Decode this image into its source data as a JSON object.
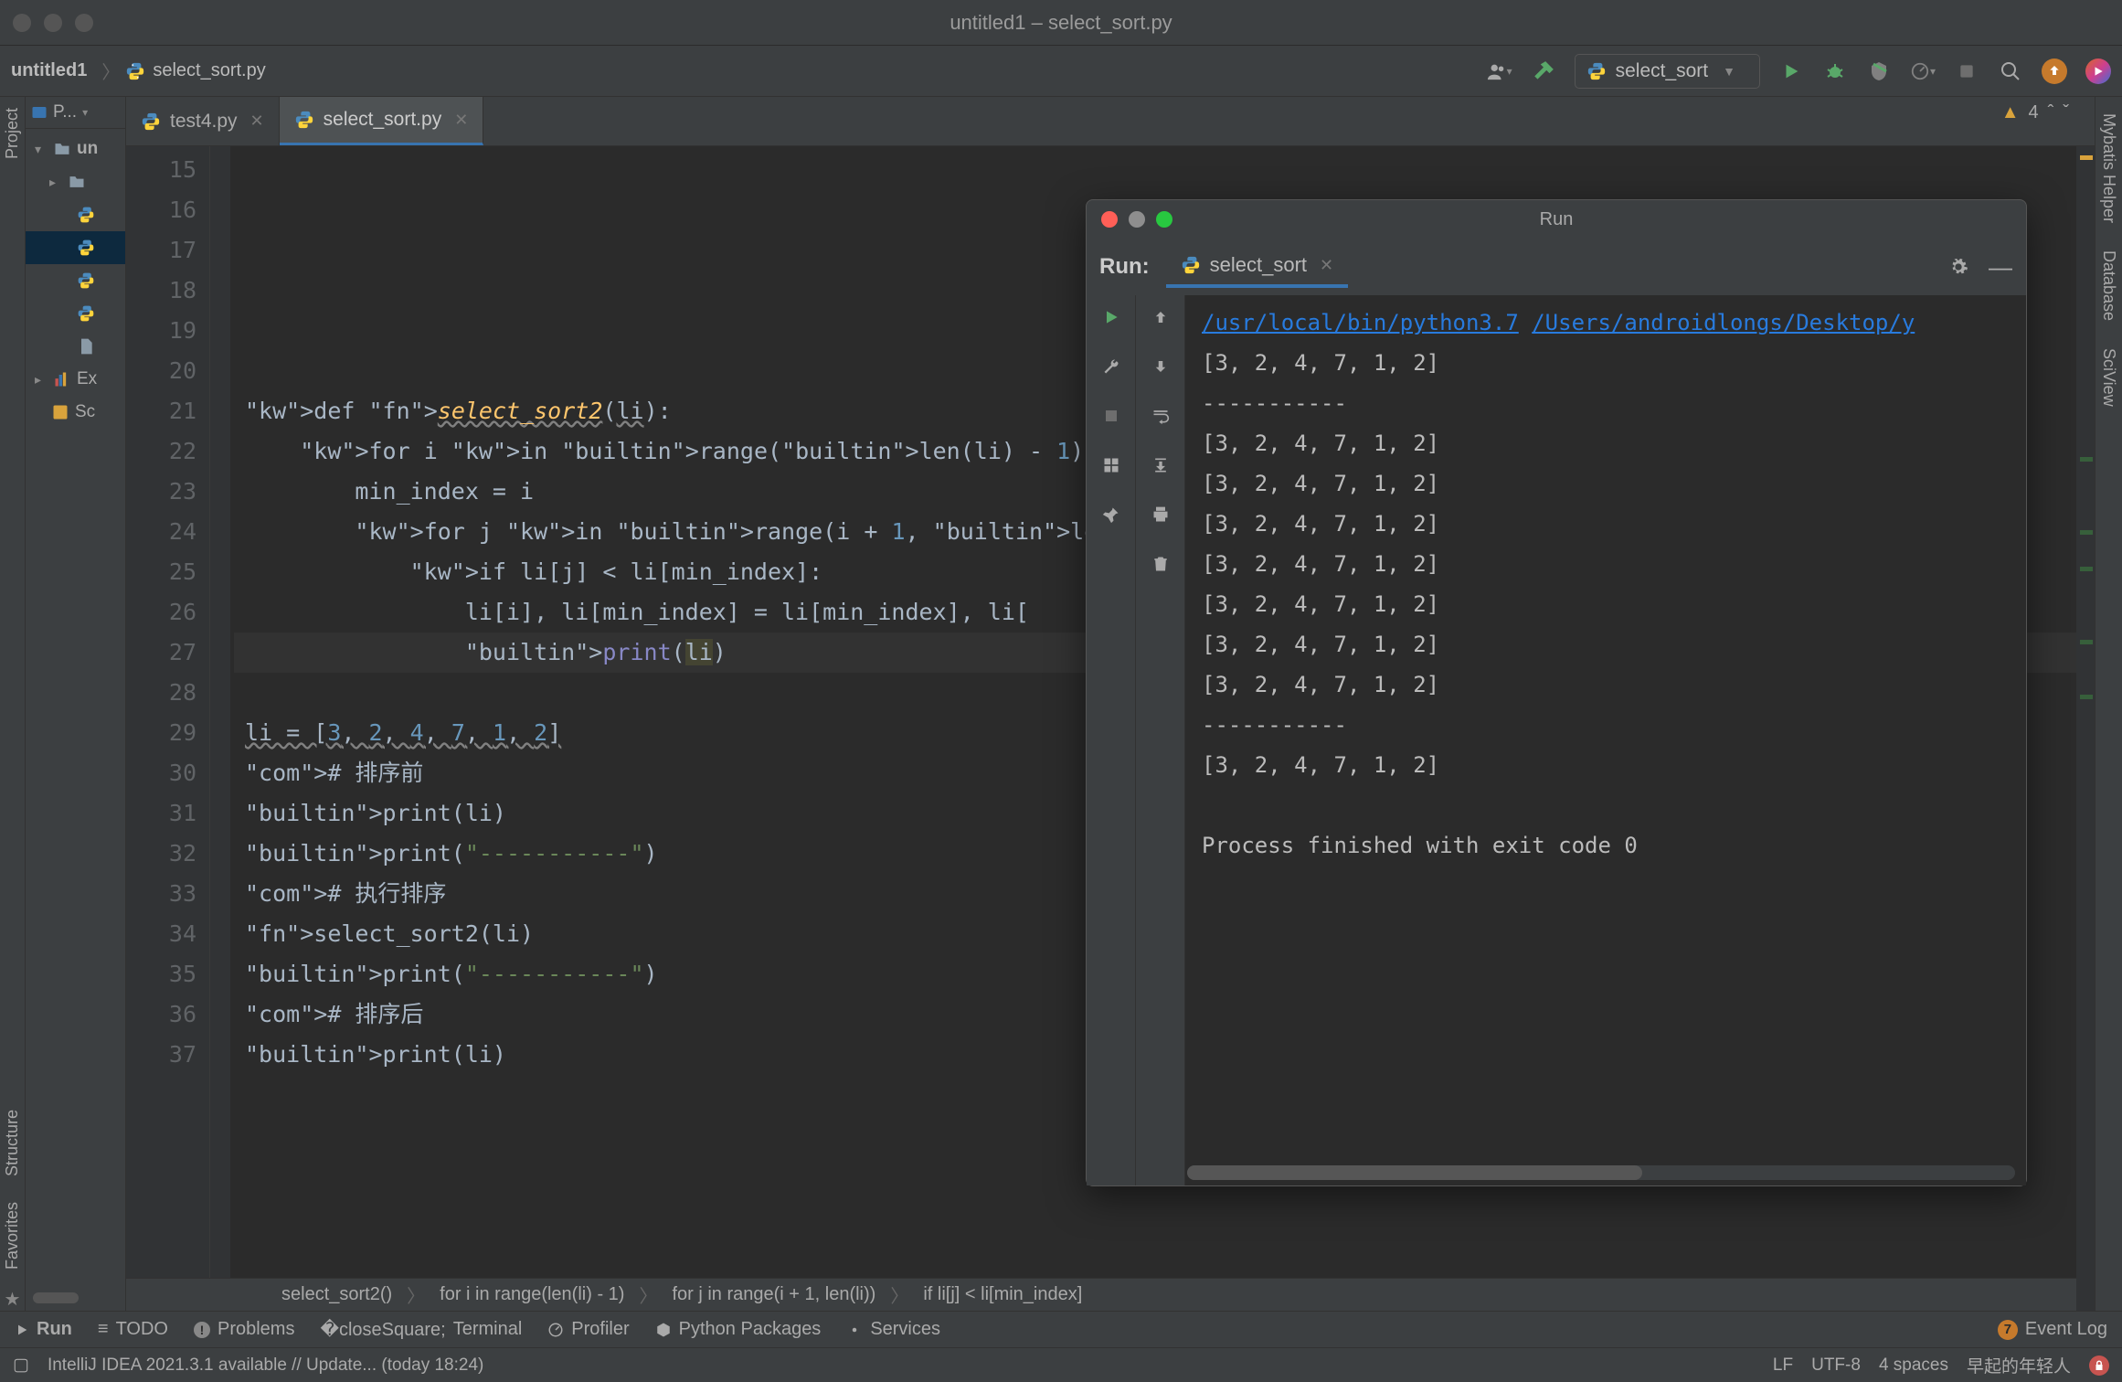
{
  "window_title": "untitled1 – select_sort.py",
  "breadcrumb_top": {
    "project": "untitled1",
    "file": "select_sort.py"
  },
  "toolbar_right": {
    "run_config": "select_sort"
  },
  "project_tree": {
    "header_label": "P...",
    "root_label": "un",
    "ext_label": "Ex",
    "sc_label": "Sc",
    "line_start": 15
  },
  "left_vert_tabs": [
    "Project",
    "Structure",
    "Favorites"
  ],
  "right_vert_tabs": [
    "Mybatis Helper",
    "Database",
    "SciView"
  ],
  "editor_tabs": [
    {
      "label": "test4.py",
      "active": false
    },
    {
      "label": "select_sort.py",
      "active": true
    }
  ],
  "warnings_count": "4",
  "code": {
    "gutter_start": 15,
    "lines": [
      "",
      "",
      "",
      "",
      "",
      "",
      "def select_sort2(li):",
      "    for i in range(len(li) - 1):",
      "        min_index = i",
      "        for j in range(i + 1, len(li)):",
      "            if li[j] < li[min_index]:",
      "                li[i], li[min_index] = li[min_index], li[",
      "                print(li)",
      "",
      "li = [3, 2, 4, 7, 1, 2]",
      "# 排序前",
      "print(li)",
      "print(\"-----------\")",
      "# 执行排序",
      "select_sort2(li)",
      "print(\"-----------\")",
      "# 排序后",
      "print(li)",
      ""
    ],
    "highlighted_line_index": 12
  },
  "breadcrumb_bottom": [
    "select_sort2()",
    "for i in range(len(li) - 1)",
    "for j in range(i + 1, len(li))",
    "if li[j] < li[min_index]"
  ],
  "run_window": {
    "title": "Run",
    "panel_label": "Run:",
    "tab_label": "select_sort",
    "link1": "/usr/local/bin/python3.7",
    "link2": "/Users/androidlongs/Desktop/y",
    "output_lines": [
      "[3, 2, 4, 7, 1, 2]",
      "-----------",
      "[3, 2, 4, 7, 1, 2]",
      "[3, 2, 4, 7, 1, 2]",
      "[3, 2, 4, 7, 1, 2]",
      "[3, 2, 4, 7, 1, 2]",
      "[3, 2, 4, 7, 1, 2]",
      "[3, 2, 4, 7, 1, 2]",
      "[3, 2, 4, 7, 1, 2]",
      "-----------",
      "[3, 2, 4, 7, 1, 2]",
      "",
      "Process finished with exit code 0"
    ]
  },
  "bottom_tools": {
    "run": "Run",
    "todo": "TODO",
    "problems": "Problems",
    "terminal": "Terminal",
    "profiler": "Profiler",
    "packages": "Python Packages",
    "services": "Services",
    "eventlog": "Event Log",
    "eventlog_badge": "7"
  },
  "status_bar": {
    "msg": "IntelliJ IDEA 2021.3.1 available // Update... (today 18:24)",
    "lf": "LF",
    "enc": "UTF-8",
    "indent": "4 spaces",
    "motto": "早起的年轻人"
  }
}
